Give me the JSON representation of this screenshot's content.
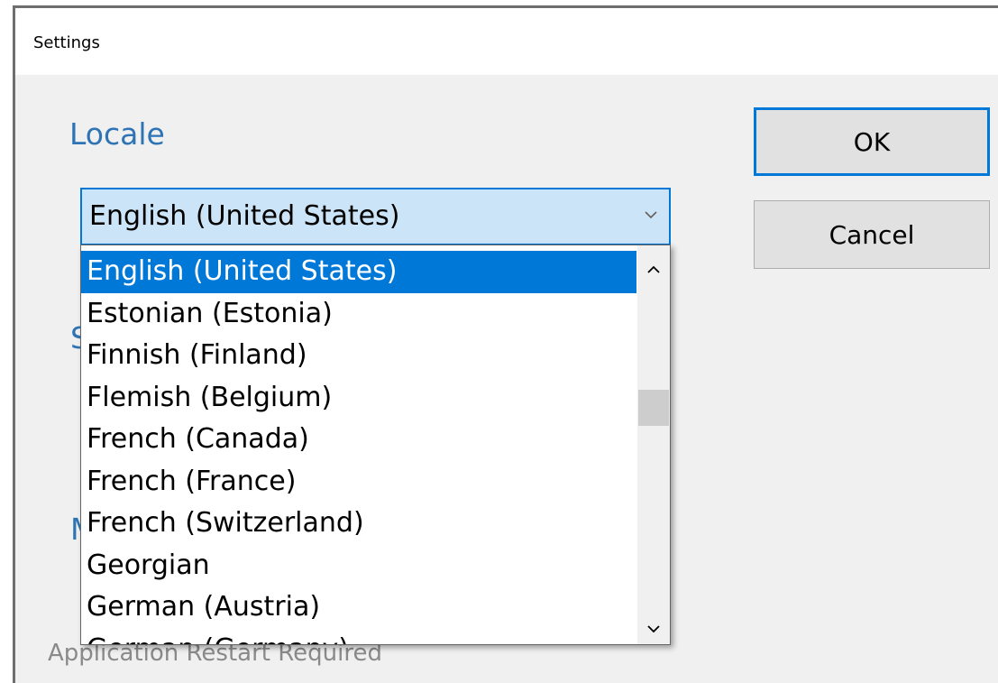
{
  "window": {
    "title": "Settings"
  },
  "labels": {
    "locale": "Locale",
    "hidden_label_s": "S",
    "hidden_label_m": "M",
    "restart_note": "Application Restart Required"
  },
  "buttons": {
    "ok": "OK",
    "cancel": "Cancel"
  },
  "locale_combo": {
    "selected": "English (United States)",
    "options": [
      "English (United States)",
      "Estonian (Estonia)",
      "Finnish (Finland)",
      "Flemish (Belgium)",
      "French (Canada)",
      "French (France)",
      "French (Switzerland)",
      "Georgian",
      "German (Austria)",
      "German (Germany)"
    ]
  },
  "colors": {
    "accent": "#0078d7",
    "label_blue": "#2e74b5",
    "combo_bg": "#cce4f7"
  },
  "icons": {
    "combo_arrow": "chevron-down-icon",
    "scroll_up": "chevron-up-icon",
    "scroll_down": "chevron-down-icon"
  }
}
